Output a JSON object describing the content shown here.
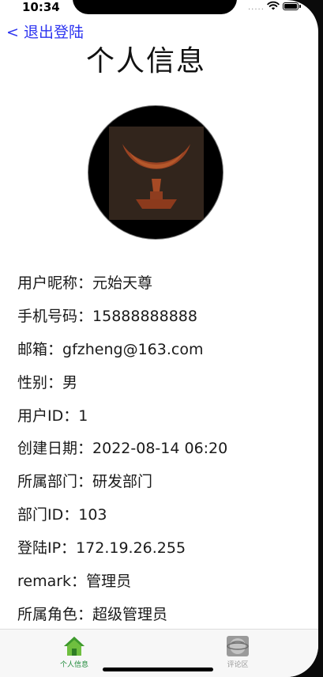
{
  "status": {
    "time": "10:34",
    "signal": "....."
  },
  "nav": {
    "back_label": "< 退出登陆",
    "title": "个人信息"
  },
  "profile": {
    "rows": [
      {
        "label": "用户昵称：",
        "value": "元始天尊"
      },
      {
        "label": "手机号码：",
        "value": "15888888888"
      },
      {
        "label": "邮箱：",
        "value": "gfzheng@163.com"
      },
      {
        "label": "性别：",
        "value": "男"
      },
      {
        "label": "用户ID：",
        "value": "1"
      },
      {
        "label": "创建日期：",
        "value": "2022-08-14 06:20"
      },
      {
        "label": "所属部门：",
        "value": "研发部门"
      },
      {
        "label": "部门ID：",
        "value": "103"
      },
      {
        "label": "登陆IP：",
        "value": "172.19.26.255"
      },
      {
        "label": "remark：",
        "value": "管理员"
      },
      {
        "label": "所属角色：",
        "value": "超级管理员"
      }
    ]
  },
  "tabbar": {
    "items": [
      {
        "label": "个人信息",
        "icon": "house-icon",
        "active": true
      },
      {
        "label": "评论区",
        "icon": "globe-icon",
        "active": false
      }
    ]
  },
  "colors": {
    "accent": "#2d34f0",
    "active_tab": "#1f8a3a",
    "inactive_tab": "#9a9a9a"
  }
}
